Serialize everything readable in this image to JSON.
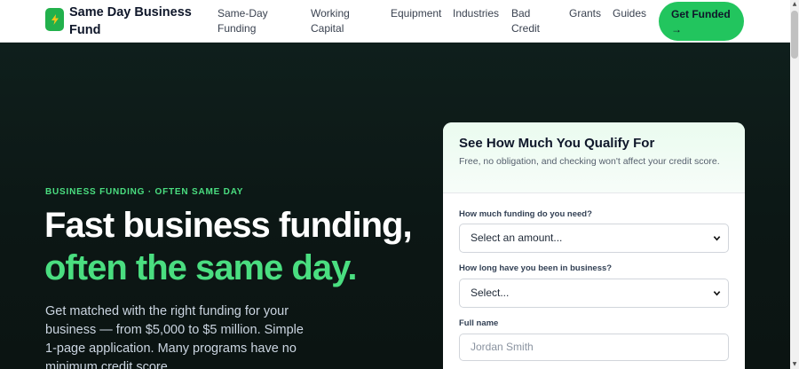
{
  "nav": {
    "brand": "Same Day Business Fund",
    "links": [
      {
        "line1": "Same-Day",
        "line2": "Funding"
      },
      {
        "line1": "Working",
        "line2": "Capital"
      },
      {
        "line1": "Equipment",
        "line2": ""
      },
      {
        "line1": "Industries",
        "line2": ""
      },
      {
        "line1": "Bad",
        "line2": "Credit"
      },
      {
        "line1": "Grants",
        "line2": ""
      },
      {
        "line1": "Guides",
        "line2": ""
      }
    ],
    "cta_label": "Get Funded →"
  },
  "hero": {
    "eyebrow": "BUSINESS FUNDING · OFTEN SAME DAY",
    "headline_line1": "Fast business funding,",
    "headline_line2": "often the same day.",
    "subtext": "Get matched with the right funding for your business — from $5,000 to $5 million. Simple 1-page application. Many programs have no minimum credit score."
  },
  "form": {
    "title": "See How Much You Qualify For",
    "description": "Free, no obligation, and checking won't affect your credit score.",
    "amount_label": "How much funding do you need?",
    "amount_selected": "Select an amount...",
    "time_label": "How long have you been in business?",
    "time_selected": "Select...",
    "name_label": "Full name",
    "name_placeholder": "Jordan Smith"
  },
  "colors": {
    "accent": "#22c55e",
    "accent_text": "#4ade80",
    "hero_bg": "#0c1715"
  },
  "icons": {
    "logo": "lightning-bolt-icon",
    "select_arrow": "chevron-down-icon"
  }
}
